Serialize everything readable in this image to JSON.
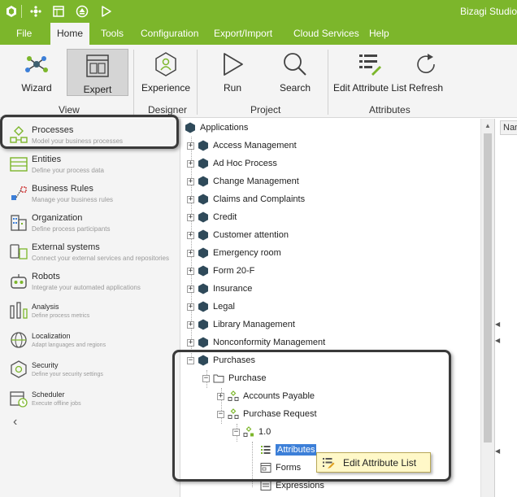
{
  "titlebar": {
    "title": "Bizagi Studio",
    "icons": [
      "bizagi-logo-icon",
      "module-icon",
      "window-icon",
      "upload-icon",
      "play-icon"
    ]
  },
  "menubar": {
    "items": [
      {
        "label": "File",
        "active": false
      },
      {
        "label": "Home",
        "active": true
      },
      {
        "label": "Tools",
        "active": false
      },
      {
        "label": "Configuration",
        "active": false
      },
      {
        "label": "Export/Import",
        "active": false
      },
      {
        "label": "Cloud Services",
        "active": false
      },
      {
        "label": "Help",
        "active": false
      }
    ]
  },
  "ribbon": {
    "buttons": [
      {
        "label": "Wizard",
        "icon": "wizard-network-icon",
        "selected": false
      },
      {
        "label": "Expert",
        "icon": "expert-layout-icon",
        "selected": true
      },
      {
        "label": "Experience",
        "icon": "experience-hexagon-icon",
        "selected": false
      },
      {
        "label": "Run",
        "icon": "run-play-icon",
        "selected": false
      },
      {
        "label": "Search",
        "icon": "search-magnifier-icon",
        "selected": false
      },
      {
        "label": "Edit Attribute List",
        "icon": "attribute-list-icon",
        "selected": false
      },
      {
        "label": "Refresh",
        "icon": "refresh-icon",
        "selected": false
      }
    ],
    "groups": [
      "View",
      "Designer",
      "Project",
      "Attributes"
    ]
  },
  "leftnav": {
    "items": [
      {
        "title": "Processes",
        "subtitle": "Model your business processes",
        "icon": "processes-icon"
      },
      {
        "title": "Entities",
        "subtitle": "Define your process data",
        "icon": "entities-icon"
      },
      {
        "title": "Business Rules",
        "subtitle": "Manage your business rules",
        "icon": "business-rules-icon"
      },
      {
        "title": "Organization",
        "subtitle": "Define process participants",
        "icon": "organization-icon"
      },
      {
        "title": "External systems",
        "subtitle": "Connect your external services and repositories",
        "icon": "external-systems-icon"
      },
      {
        "title": "Robots",
        "subtitle": "Integrate your automated applications",
        "icon": "robots-icon"
      },
      {
        "title": "Analysis",
        "subtitle": "Define process metrics",
        "icon": "analysis-icon"
      },
      {
        "title": "Localization",
        "subtitle": "Adapt languages and regions",
        "icon": "localization-icon"
      },
      {
        "title": "Security",
        "subtitle": "Define your security settings",
        "icon": "security-icon"
      },
      {
        "title": "Scheduler",
        "subtitle": "Execute offline jobs",
        "icon": "scheduler-icon"
      }
    ],
    "collapse_glyph": "‹"
  },
  "tree": {
    "root": "Applications",
    "applications": [
      "Access Management",
      "Ad Hoc Process",
      "Change Management",
      "Claims and Complaints",
      "Credit",
      "Customer attention",
      "Emergency room",
      "Form 20-F",
      "Insurance",
      "Legal",
      "Library Management",
      "Nonconformity Management",
      "Purchases"
    ],
    "purchase_folder": "Purchase",
    "processes": [
      "Accounts Payable",
      "Purchase Request"
    ],
    "version": "1.0",
    "version_children": [
      "Attributes",
      "Forms",
      "Expressions"
    ],
    "selected": "Attributes"
  },
  "rightpanel": {
    "header": "Name"
  },
  "context_menu": {
    "label": "Edit Attribute List",
    "icon": "edit-attribute-list-icon"
  },
  "colors": {
    "brand": "#7cb62b",
    "selection": "#3c7fd8",
    "context_bg": "#fff8c8",
    "hexagon": "#2f4a5a"
  }
}
